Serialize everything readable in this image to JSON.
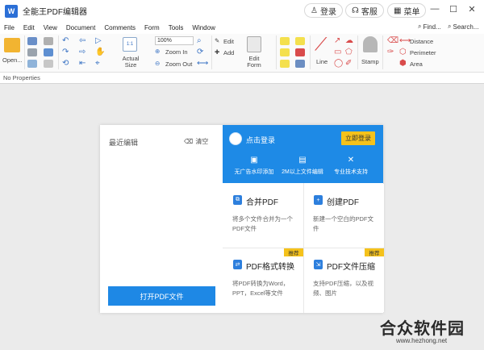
{
  "window": {
    "title": "全能王PDF编辑器",
    "logo_letter": "W",
    "login_label": "登录",
    "service_label": "客服",
    "menu_label": "菜单",
    "minimize": "—",
    "close": "✕",
    "restore": "☐"
  },
  "menu": {
    "items": [
      "File",
      "Edit",
      "View",
      "Document",
      "Comments",
      "Form",
      "Tools",
      "Window"
    ],
    "find": "Find...",
    "search": "Search..."
  },
  "ribbon": {
    "open": "Open...",
    "zoom_value": "100%",
    "zoom_in": "Zoom In",
    "zoom_out": "Zoom Out",
    "actual_size": "Actual Size",
    "edit": "Edit",
    "add": "Add",
    "edit_form": "Edit Form",
    "line": "Line",
    "stamp": "Stamp",
    "distance": "Distance",
    "perimeter": "Perimeter",
    "area": "Area",
    "page_count_icon": "1:1"
  },
  "properties_bar": "No Properties",
  "dialog": {
    "recent_title": "最近编辑",
    "clear_label": "清空",
    "open_pdf": "打开PDF文件",
    "login_prompt": "点击登录",
    "login_now": "立即登录",
    "features": [
      "无广告水印添加",
      "2M以上文件编辑",
      "专业技术支持"
    ],
    "cards": [
      {
        "title": "合并PDF",
        "desc": "将多个文件合并为一个PDF文件",
        "tag": ""
      },
      {
        "title": "创建PDF",
        "desc": "新建一个空白的PDF文件",
        "tag": ""
      },
      {
        "title": "PDF格式转换",
        "desc": "将PDF转换为Word，PPT，Excel等文件",
        "tag": "推荐"
      },
      {
        "title": "PDF文件压缩",
        "desc": "支持PDF压缩，以及视频、图片",
        "tag": "推荐"
      }
    ]
  },
  "watermark": {
    "text": "合众软件园",
    "url": "www.hezhong.net"
  },
  "colors": {
    "accent_blue": "#1e88e5",
    "badge_yellow": "#f5c21b",
    "workspace_grey": "#ebebeb"
  }
}
